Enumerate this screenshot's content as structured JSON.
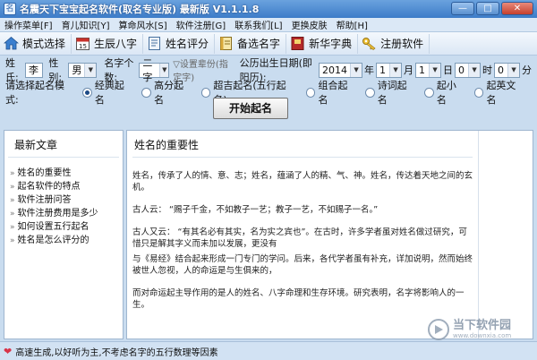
{
  "window": {
    "title": "名震天下宝宝起名软件(取名专业版) 最新版 V1.1.1.8",
    "controls": [
      "—",
      "□",
      "✕"
    ]
  },
  "menu": [
    "操作菜单[F]",
    "育儿知识[Y]",
    "算命风水[S]",
    "软件注册[G]",
    "联系我们[L]",
    "更换皮肤",
    "帮助[H]"
  ],
  "toolbar": [
    {
      "label": "模式选择",
      "icon": "home-icon"
    },
    {
      "label": "生辰八字",
      "icon": "calendar-icon"
    },
    {
      "label": "姓名评分",
      "icon": "document-icon"
    },
    {
      "label": "备选名字",
      "icon": "notebook-icon"
    },
    {
      "label": "新华字典",
      "icon": "dictionary-icon"
    },
    {
      "label": "注册软件",
      "icon": "key-icon"
    }
  ],
  "form": {
    "surname_label": "姓氏:",
    "surname_value": "李",
    "gender_label": "性别:",
    "gender_value": "男",
    "name_chars_label": "名字个数:",
    "name_chars_value": "二字",
    "fixed_char_hint": "▽设置辈份(指定字)",
    "birth_label": "公历出生日期(即阳历):",
    "year_value": "2014",
    "year_unit": "年",
    "month_value": "1",
    "month_unit": "月",
    "day_value": "1",
    "day_unit": "日",
    "hour_value": "0",
    "hour_unit": "时",
    "minute_value": "0",
    "minute_unit": "分"
  },
  "modes": {
    "label": "请选择起名模式:",
    "options": [
      "经典起名",
      "高分起名",
      "超吉起名(五行起名)",
      "组合起名",
      "诗词起名",
      "起小名",
      "起英文名"
    ],
    "selected_index": 0
  },
  "start_button": "开始起名",
  "left_panel": {
    "title": "最新文章",
    "articles": [
      "姓名的重要性",
      "起名软件的特点",
      "软件注册问答",
      "软件注册费用是多少",
      "如何设置五行起名",
      "姓名是怎么评分的"
    ]
  },
  "content": {
    "title": "姓名的重要性",
    "paragraphs": [
      "姓名，传承了人的情、意、志；姓名，蕴涵了人的精、气、神。姓名，传达着天地之间的玄机。",
      "古人云： “赐子千金，不如教子一艺；教子一艺，不如赐子一名。”",
      "古人又云： “有其名必有其实，名为实之宾也”。在古时，许多学者虽对姓名做过研究，可惜只是解其字义而未加以发展，更没有",
      "与《易经》结合起来形成一门专门的学问。后来，各代学者虽有补充，详加说明，然而始终被世人忽视，人的命运是与生俱来的，",
      "而对命运起主导作用的是人的姓名、八字命理和生存环境。研究表明，名字将影响人的一生。"
    ]
  },
  "status": {
    "text": "高速生成,以好听为主,不考虑名字的五行数理等因素"
  },
  "watermark": {
    "title": "当下软件园",
    "subtitle": "www.downxia.com"
  }
}
